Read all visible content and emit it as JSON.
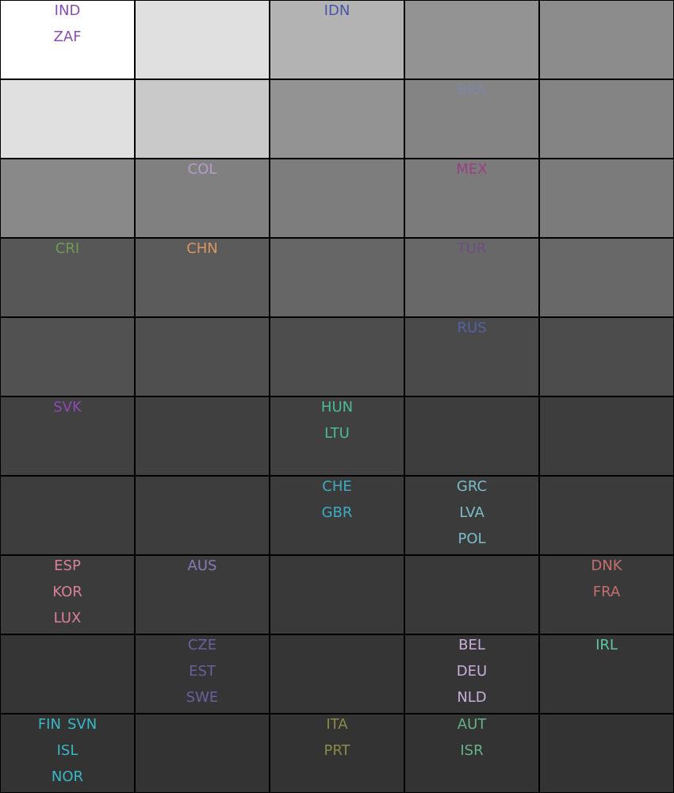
{
  "chart_data": {
    "type": "heatmap",
    "title": "",
    "xlabel": "",
    "ylabel": "",
    "rows": 10,
    "cols": 5,
    "shades": [
      [
        "#ffffff",
        "#e0e0e0",
        "#b3b3b3",
        "#939393",
        "#8c8c8c"
      ],
      [
        "#e0e0e0",
        "#c9c9c9",
        "#939393",
        "#848484",
        "#848484"
      ],
      [
        "#898989",
        "#808080",
        "#7d7d7d",
        "#7b7b7b",
        "#7b7b7b"
      ],
      [
        "#575757",
        "#5b5b5b",
        "#666666",
        "#686868",
        "#686868"
      ],
      [
        "#515151",
        "#4f4f4f",
        "#4d4d4d",
        "#4a4a4a",
        "#4c4c4c"
      ],
      [
        "#414141",
        "#404040",
        "#404040",
        "#3d3d3d",
        "#3d3d3d"
      ],
      [
        "#3d3d3d",
        "#3d3d3d",
        "#3b3b3b",
        "#3b3b3b",
        "#3b3b3b"
      ],
      [
        "#3b3b3b",
        "#3b3b3b",
        "#393939",
        "#393939",
        "#393939"
      ],
      [
        "#353535",
        "#353535",
        "#353535",
        "#353535",
        "#353535"
      ],
      [
        "#333333",
        "#333333",
        "#333333",
        "#333333",
        "#333333"
      ]
    ],
    "cells": [
      {
        "row": 0,
        "col": 0,
        "labels": [
          "IND",
          "ZAF"
        ],
        "color": "#8a4db3"
      },
      {
        "row": 0,
        "col": 2,
        "labels": [
          "IDN"
        ],
        "color": "#4a55a8"
      },
      {
        "row": 1,
        "col": 3,
        "labels": [
          "BRA"
        ],
        "color": "#7f86a6"
      },
      {
        "row": 2,
        "col": 1,
        "labels": [
          "COL"
        ],
        "color": "#b59bc9"
      },
      {
        "row": 2,
        "col": 3,
        "labels": [
          "MEX"
        ],
        "color": "#9c3d86"
      },
      {
        "row": 3,
        "col": 0,
        "labels": [
          "CRI"
        ],
        "color": "#6e9c52"
      },
      {
        "row": 3,
        "col": 1,
        "labels": [
          "CHN"
        ],
        "color": "#d9965e"
      },
      {
        "row": 3,
        "col": 3,
        "labels": [
          "TUR"
        ],
        "color": "#6d4f80"
      },
      {
        "row": 4,
        "col": 3,
        "labels": [
          "RUS"
        ],
        "color": "#5561a6"
      },
      {
        "row": 5,
        "col": 0,
        "labels": [
          "SVK"
        ],
        "color": "#8f49b3"
      },
      {
        "row": 5,
        "col": 2,
        "labels": [
          "HUN",
          "LTU"
        ],
        "color": "#4abc8f"
      },
      {
        "row": 6,
        "col": 2,
        "labels": [
          "CHE",
          "GBR"
        ],
        "color": "#3eabc4"
      },
      {
        "row": 6,
        "col": 3,
        "labels": [
          "GRC",
          "LVA",
          "POL"
        ],
        "color": "#7cbcc9"
      },
      {
        "row": 7,
        "col": 0,
        "labels": [
          "ESP",
          "KOR",
          "LUX"
        ],
        "color": "#d9829a"
      },
      {
        "row": 7,
        "col": 1,
        "labels": [
          "AUS"
        ],
        "color": "#8a78b8"
      },
      {
        "row": 7,
        "col": 4,
        "labels": [
          "DNK",
          "FRA"
        ],
        "color": "#c46e6e"
      },
      {
        "row": 8,
        "col": 1,
        "labels": [
          "CZE",
          "EST",
          "SWE"
        ],
        "color": "#6d5f9e"
      },
      {
        "row": 8,
        "col": 3,
        "labels": [
          "BEL",
          "DEU",
          "NLD"
        ],
        "color": "#c7aedb"
      },
      {
        "row": 8,
        "col": 4,
        "labels": [
          "IRL"
        ],
        "color": "#5ec7a0"
      },
      {
        "row": 9,
        "col": 0,
        "labels": [
          "FIN",
          "SVN",
          "ISL",
          "NOR"
        ],
        "color": "#38b8c7"
      },
      {
        "row": 9,
        "col": 2,
        "labels": [
          "ITA",
          "PRT"
        ],
        "color": "#8c8a48"
      },
      {
        "row": 9,
        "col": 3,
        "labels": [
          "AUT",
          "ISR"
        ],
        "color": "#66b08c"
      }
    ]
  }
}
